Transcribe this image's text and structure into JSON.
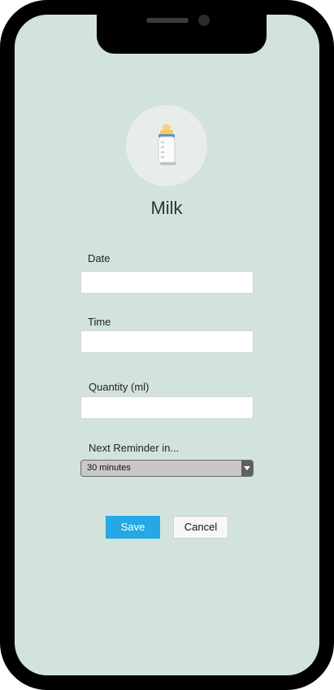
{
  "title": "Milk",
  "icon": "baby-bottle-icon",
  "form": {
    "date_label": "Date",
    "date_value": "",
    "time_label": "Time",
    "time_value": "",
    "quantity_label": "Quantity (ml)",
    "quantity_value": "",
    "reminder_label": "Next Reminder in...",
    "reminder_selected": "30 minutes"
  },
  "buttons": {
    "save_label": "Save",
    "cancel_label": "Cancel"
  },
  "colors": {
    "screen_background": "#d2e3dc",
    "save_button": "#24a9e6"
  }
}
